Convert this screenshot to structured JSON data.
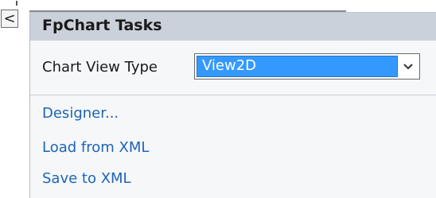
{
  "panel": {
    "title": "FpChart Tasks",
    "collapse_glyph": "<"
  },
  "chart_view_type": {
    "label": "Chart View Type",
    "selected": "View2D"
  },
  "actions": {
    "designer": "Designer...",
    "load_xml": "Load from XML",
    "save_xml": "Save to XML"
  },
  "icons": {
    "collapse": "chevron-left-icon",
    "dropdown": "chevron-down-icon"
  },
  "colors": {
    "header_bg": "#cbd1da",
    "panel_bg": "#f5f7f9",
    "link": "#1e64b4",
    "selection": "#3399ff"
  }
}
